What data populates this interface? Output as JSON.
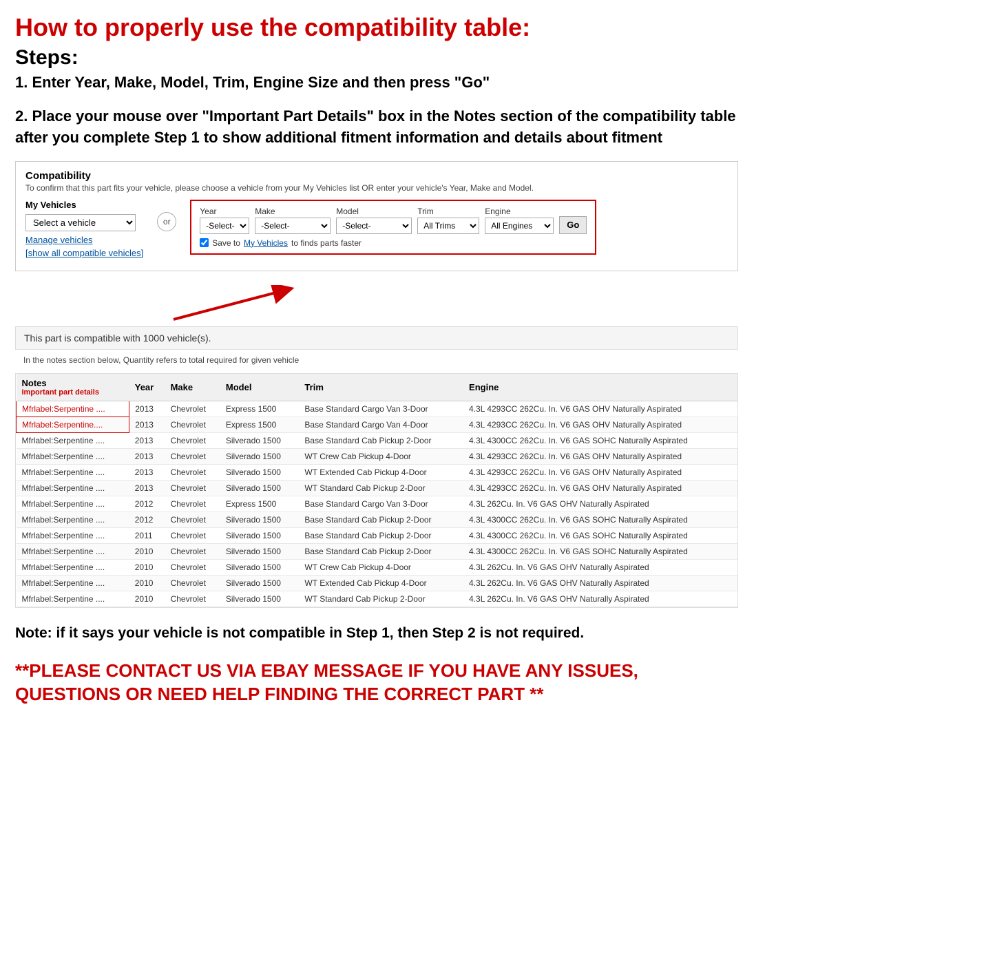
{
  "page": {
    "main_title": "How to properly use the compatibility table:",
    "steps_label": "Steps:",
    "step1": "1. Enter Year, Make, Model, Trim, Engine Size and then press \"Go\"",
    "step2": "2. Place your mouse over \"Important Part Details\" box in the Notes section of the compatibility table after you complete Step 1 to show additional fitment information and details about fitment",
    "note": "Note: if it says your vehicle is not compatible in Step 1, then Step 2 is not required.",
    "contact": "**PLEASE CONTACT US VIA EBAY MESSAGE IF YOU HAVE ANY ISSUES, QUESTIONS OR NEED HELP FINDING THE CORRECT PART **"
  },
  "compatibility": {
    "title": "Compatibility",
    "subtitle": "To confirm that this part fits your vehicle, please choose a vehicle from your My Vehicles list OR enter your vehicle's Year, Make and Model.",
    "my_vehicles_label": "My Vehicles",
    "select_vehicle_placeholder": "Select a vehicle",
    "manage_vehicles": "Manage vehicles",
    "show_all": "[show all compatible vehicles]",
    "or_label": "or",
    "year_label": "Year",
    "year_placeholder": "-Select-",
    "make_label": "Make",
    "make_placeholder": "-Select-",
    "model_label": "Model",
    "model_placeholder": "-Select-",
    "trim_label": "Trim",
    "trim_value": "All Trims",
    "engine_label": "Engine",
    "engine_value": "All Engines",
    "go_button": "Go",
    "save_text_prefix": "Save to ",
    "save_link": "My Vehicles",
    "save_text_suffix": " to finds parts faster",
    "compatible_count": "This part is compatible with 1000 vehicle(s).",
    "quantity_note": "In the notes section below, Quantity refers to total required for given vehicle"
  },
  "table": {
    "headers": [
      "Notes",
      "Year",
      "Make",
      "Model",
      "Trim",
      "Engine"
    ],
    "subheader": "Important part details",
    "rows": [
      {
        "notes": "Mfrlabel:Serpentine ....",
        "year": "2013",
        "make": "Chevrolet",
        "model": "Express 1500",
        "trim": "Base Standard Cargo Van 3-Door",
        "engine": "4.3L 4293CC 262Cu. In. V6 GAS OHV Naturally Aspirated"
      },
      {
        "notes": "Mfrlabel:Serpentine....",
        "year": "2013",
        "make": "Chevrolet",
        "model": "Express 1500",
        "trim": "Base Standard Cargo Van 4-Door",
        "engine": "4.3L 4293CC 262Cu. In. V6 GAS OHV Naturally Aspirated"
      },
      {
        "notes": "Mfrlabel:Serpentine ....",
        "year": "2013",
        "make": "Chevrolet",
        "model": "Silverado 1500",
        "trim": "Base Standard Cab Pickup 2-Door",
        "engine": "4.3L 4300CC 262Cu. In. V6 GAS SOHC Naturally Aspirated"
      },
      {
        "notes": "Mfrlabel:Serpentine ....",
        "year": "2013",
        "make": "Chevrolet",
        "model": "Silverado 1500",
        "trim": "WT Crew Cab Pickup 4-Door",
        "engine": "4.3L 4293CC 262Cu. In. V6 GAS OHV Naturally Aspirated"
      },
      {
        "notes": "Mfrlabel:Serpentine ....",
        "year": "2013",
        "make": "Chevrolet",
        "model": "Silverado 1500",
        "trim": "WT Extended Cab Pickup 4-Door",
        "engine": "4.3L 4293CC 262Cu. In. V6 GAS OHV Naturally Aspirated"
      },
      {
        "notes": "Mfrlabel:Serpentine ....",
        "year": "2013",
        "make": "Chevrolet",
        "model": "Silverado 1500",
        "trim": "WT Standard Cab Pickup 2-Door",
        "engine": "4.3L 4293CC 262Cu. In. V6 GAS OHV Naturally Aspirated"
      },
      {
        "notes": "Mfrlabel:Serpentine ....",
        "year": "2012",
        "make": "Chevrolet",
        "model": "Express 1500",
        "trim": "Base Standard Cargo Van 3-Door",
        "engine": "4.3L 262Cu. In. V6 GAS OHV Naturally Aspirated"
      },
      {
        "notes": "Mfrlabel:Serpentine ....",
        "year": "2012",
        "make": "Chevrolet",
        "model": "Silverado 1500",
        "trim": "Base Standard Cab Pickup 2-Door",
        "engine": "4.3L 4300CC 262Cu. In. V6 GAS SOHC Naturally Aspirated"
      },
      {
        "notes": "Mfrlabel:Serpentine ....",
        "year": "2011",
        "make": "Chevrolet",
        "model": "Silverado 1500",
        "trim": "Base Standard Cab Pickup 2-Door",
        "engine": "4.3L 4300CC 262Cu. In. V6 GAS SOHC Naturally Aspirated"
      },
      {
        "notes": "Mfrlabel:Serpentine ....",
        "year": "2010",
        "make": "Chevrolet",
        "model": "Silverado 1500",
        "trim": "Base Standard Cab Pickup 2-Door",
        "engine": "4.3L 4300CC 262Cu. In. V6 GAS SOHC Naturally Aspirated"
      },
      {
        "notes": "Mfrlabel:Serpentine ....",
        "year": "2010",
        "make": "Chevrolet",
        "model": "Silverado 1500",
        "trim": "WT Crew Cab Pickup 4-Door",
        "engine": "4.3L 262Cu. In. V6 GAS OHV Naturally Aspirated"
      },
      {
        "notes": "Mfrlabel:Serpentine ....",
        "year": "2010",
        "make": "Chevrolet",
        "model": "Silverado 1500",
        "trim": "WT Extended Cab Pickup 4-Door",
        "engine": "4.3L 262Cu. In. V6 GAS OHV Naturally Aspirated"
      },
      {
        "notes": "Mfrlabel:Serpentine ....",
        "year": "2010",
        "make": "Chevrolet",
        "model": "Silverado 1500",
        "trim": "WT Standard Cab Pickup 2-Door",
        "engine": "4.3L 262Cu. In. V6 GAS OHV Naturally Aspirated"
      }
    ]
  }
}
